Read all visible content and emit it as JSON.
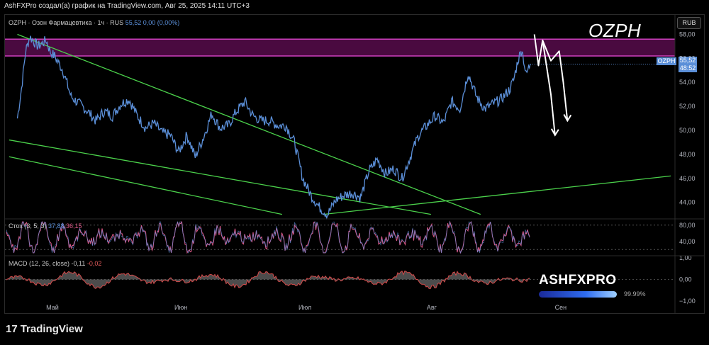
{
  "header": {
    "caption": "AshFXPro создал(а) график на TradingView.com, Авг 25, 2025 14:11 UTC+3"
  },
  "legend": {
    "symbol_line": "OZPH · Озон Фармацевтика · 1ч · RUS",
    "price": "55,52",
    "change": "0,00 (0,00%)"
  },
  "overlay": {
    "ticker_big": "OZPH",
    "currency": "RUB",
    "last_price_symbol": "OZPH",
    "last_price": "55,52",
    "countdown": "48:52"
  },
  "stoch": {
    "label": "Стох (3, 5, 3)",
    "k": "37,88",
    "d": "36,15"
  },
  "macd": {
    "label": "MACD (12, 26, close)",
    "macd": "-0,11",
    "signal": "-0,02"
  },
  "branding": {
    "name": "ASHFXPRO",
    "percent": "99.99%"
  },
  "footer": {
    "logo_text": "TradingView"
  },
  "colors": {
    "price_line": "#5b8fd8",
    "trendline": "#4bd14b",
    "zone_fill": "#4a0a40",
    "zone_border": "#d040c0",
    "stoch_k": "#5b8fd8",
    "stoch_d": "#e05a8a",
    "macd_hist_pos": "#3a3a3a",
    "macd_line": "#d44a4a",
    "projection": "#ffffff"
  },
  "chart_data": [
    {
      "type": "line",
      "title": "OZPH · Озон Фармацевтика · 1ч · RUS",
      "x_labels": [
        "Май",
        "Июн",
        "Июл",
        "Авг",
        "Сен"
      ],
      "y_ticks": [
        "44,00",
        "46,00",
        "48,00",
        "50,00",
        "52,00",
        "54,00",
        "56,00",
        "58,00"
      ],
      "ylim": [
        42.8,
        58.5
      ],
      "price_series": [
        [
          "2025-04-23",
          51.0
        ],
        [
          "2025-04-24",
          53.5
        ],
        [
          "2025-04-25",
          56.6
        ],
        [
          "2025-04-26",
          57.8
        ],
        [
          "2025-04-28",
          57.0
        ],
        [
          "2025-04-30",
          57.5
        ],
        [
          "2025-05-01",
          56.5
        ],
        [
          "2025-05-02",
          56.2
        ],
        [
          "2025-05-04",
          55.0
        ],
        [
          "2025-05-06",
          52.8
        ],
        [
          "2025-05-08",
          52.2
        ],
        [
          "2025-05-10",
          51.6
        ],
        [
          "2025-05-12",
          50.8
        ],
        [
          "2025-05-14",
          51.6
        ],
        [
          "2025-05-16",
          51.2
        ],
        [
          "2025-05-18",
          52.2
        ],
        [
          "2025-05-20",
          52.6
        ],
        [
          "2025-05-22",
          51.2
        ],
        [
          "2025-05-24",
          50.2
        ],
        [
          "2025-05-26",
          50.6
        ],
        [
          "2025-05-28",
          49.8
        ],
        [
          "2025-05-30",
          49.6
        ],
        [
          "2025-06-01",
          48.2
        ],
        [
          "2025-06-03",
          49.6
        ],
        [
          "2025-06-05",
          47.8
        ],
        [
          "2025-06-07",
          49.4
        ],
        [
          "2025-06-09",
          51.4
        ],
        [
          "2025-06-11",
          50.2
        ],
        [
          "2025-06-13",
          50.4
        ],
        [
          "2025-06-15",
          51.6
        ],
        [
          "2025-06-17",
          52.4
        ],
        [
          "2025-06-19",
          51.2
        ],
        [
          "2025-06-21",
          50.8
        ],
        [
          "2025-06-23",
          50.8
        ],
        [
          "2025-06-25",
          50.4
        ],
        [
          "2025-06-27",
          50.4
        ],
        [
          "2025-06-29",
          49.0
        ],
        [
          "2025-07-01",
          46.0
        ],
        [
          "2025-07-03",
          44.6
        ],
        [
          "2025-07-05",
          43.6
        ],
        [
          "2025-07-07",
          43.0
        ],
        [
          "2025-07-09",
          44.2
        ],
        [
          "2025-07-11",
          44.6
        ],
        [
          "2025-07-13",
          44.8
        ],
        [
          "2025-07-15",
          44.4
        ],
        [
          "2025-07-17",
          46.6
        ],
        [
          "2025-07-19",
          47.6
        ],
        [
          "2025-07-21",
          46.4
        ],
        [
          "2025-07-23",
          46.8
        ],
        [
          "2025-07-25",
          46.0
        ],
        [
          "2025-07-27",
          47.8
        ],
        [
          "2025-07-29",
          49.6
        ],
        [
          "2025-07-31",
          50.4
        ],
        [
          "2025-08-02",
          51.2
        ],
        [
          "2025-08-04",
          50.6
        ],
        [
          "2025-08-06",
          52.4
        ],
        [
          "2025-08-08",
          51.8
        ],
        [
          "2025-08-10",
          54.8
        ],
        [
          "2025-08-12",
          52.8
        ],
        [
          "2025-08-14",
          51.8
        ],
        [
          "2025-08-16",
          52.2
        ],
        [
          "2025-08-18",
          52.6
        ],
        [
          "2025-08-20",
          53.4
        ],
        [
          "2025-08-21",
          54.2
        ],
        [
          "2025-08-22",
          55.8
        ],
        [
          "2025-08-23",
          56.8
        ],
        [
          "2025-08-24",
          54.6
        ],
        [
          "2025-08-25",
          55.52
        ]
      ],
      "resistance_zone": [
        56.2,
        57.6
      ],
      "last_price": 55.52,
      "trendlines": [
        {
          "from": [
            "2025-04-23",
            58.0
          ],
          "to": [
            "2025-08-13",
            43.0
          ]
        },
        {
          "from": [
            "2025-04-21",
            49.2
          ],
          "to": [
            "2025-08-01",
            43.0
          ]
        },
        {
          "from": [
            "2025-04-21",
            47.8
          ],
          "to": [
            "2025-06-26",
            43.0
          ]
        },
        {
          "from": [
            "2025-07-06",
            43.0
          ],
          "to": [
            "2025-09-28",
            46.2
          ]
        }
      ],
      "projection_paths": [
        [
          [
            "2025-08-26",
            58.0
          ],
          [
            "2025-08-27",
            55.4
          ],
          [
            "2025-08-28",
            57.5
          ],
          [
            "2025-08-30",
            53.0
          ],
          [
            "2025-08-31",
            49.6
          ]
        ],
        [
          [
            "2025-08-28",
            57.5
          ],
          [
            "2025-08-30",
            55.8
          ],
          [
            "2025-09-01",
            56.6
          ],
          [
            "2025-09-02",
            54.0
          ],
          [
            "2025-09-03",
            50.8
          ]
        ]
      ]
    },
    {
      "type": "line",
      "title": "Стох (3, 5, 3)",
      "y_ticks": [
        "40,00",
        "80,00"
      ],
      "ylim": [
        10,
        90
      ],
      "levels": [
        80,
        20
      ],
      "series": [
        {
          "name": "K",
          "last": 37.88
        },
        {
          "name": "D",
          "last": 36.15
        }
      ]
    },
    {
      "type": "line",
      "title": "MACD (12, 26, close)",
      "y_ticks": [
        "1,00",
        "0,00",
        "−1,00"
      ],
      "ylim": [
        -1.0,
        1.0
      ],
      "series": [
        {
          "name": "MACD",
          "last": -0.11
        },
        {
          "name": "Signal",
          "last": -0.02
        }
      ]
    }
  ]
}
